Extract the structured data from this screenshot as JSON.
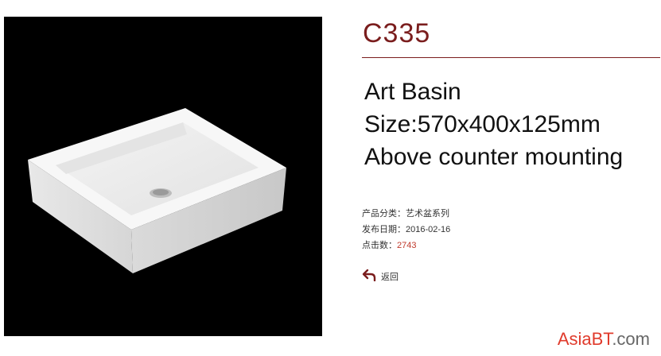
{
  "product": {
    "code": "C335",
    "description_lines": [
      "Art Basin",
      "Size:570x400x125mm",
      "Above counter mounting"
    ]
  },
  "meta": {
    "category_label": "产品分类：",
    "category_value": "艺术盆系列",
    "date_label": "发布日期：",
    "date_value": "2016-02-16",
    "hits_label": "点击数：",
    "hits_value": "2743"
  },
  "back_label": "返回",
  "watermark": {
    "brand": "AsiaBT",
    "suffix": ".com"
  },
  "colors": {
    "accent": "#7a1d1d",
    "hits": "#c0392b",
    "watermark": "#e03b2c"
  }
}
